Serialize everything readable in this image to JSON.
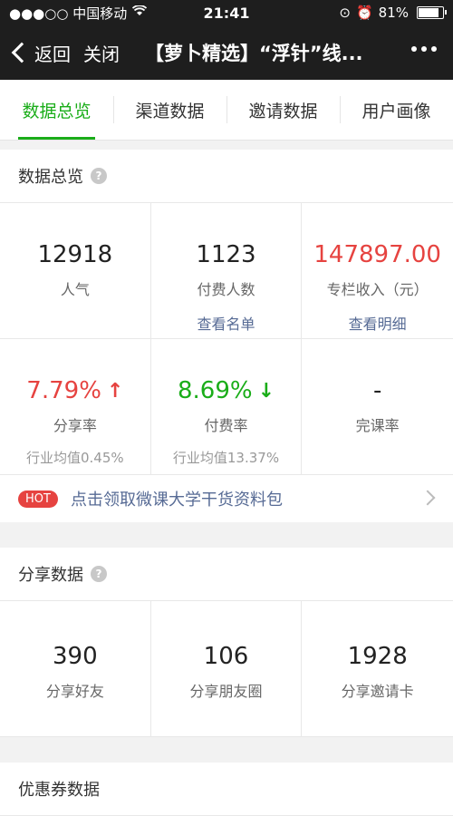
{
  "status": {
    "carrier": "●●●○○ 中国移动",
    "time": "21:41",
    "battery": "81%"
  },
  "nav": {
    "back_label": "返回",
    "close_label": "关闭",
    "title": "【萝卜精选】“浮针”线..."
  },
  "tabs": [
    "数据总览",
    "渠道数据",
    "邀请数据",
    "用户画像"
  ],
  "overview": {
    "title": "数据总览",
    "help": "?",
    "popularity": {
      "value": "12918",
      "label": "人气"
    },
    "paid_users": {
      "value": "1123",
      "label": "付费人数",
      "link": "查看名单"
    },
    "income": {
      "value": "147897.00",
      "label": "专栏收入（元）",
      "link": "查看明细"
    },
    "share_rate": {
      "value": "7.79%",
      "label": "分享率",
      "avg": "行业均值0.45%"
    },
    "pay_rate": {
      "value": "8.69%",
      "label": "付费率",
      "avg": "行业均值13.37%"
    },
    "completion": {
      "value": "-",
      "label": "完课率"
    },
    "hot_badge": "HOT",
    "hot_text": "点击领取微课大学干货资料包"
  },
  "share": {
    "title": "分享数据",
    "help": "?",
    "friends": {
      "value": "390",
      "label": "分享好友"
    },
    "moments": {
      "value": "106",
      "label": "分享朋友圈"
    },
    "invite_card": {
      "value": "1928",
      "label": "分享邀请卡"
    }
  },
  "coupon": {
    "title": "优惠券数据"
  },
  "colors": {
    "accent": "#1aad19",
    "red": "#e64340",
    "link": "#576b95",
    "header": "#1e1e1e"
  }
}
